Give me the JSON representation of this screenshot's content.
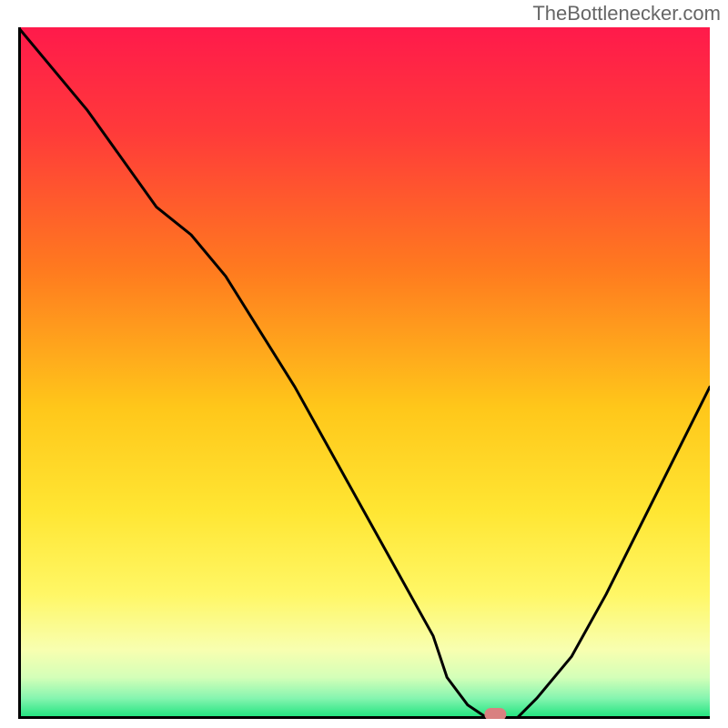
{
  "watermark": "TheBottlenecker.com",
  "chart_data": {
    "type": "line",
    "title": "",
    "xlabel": "",
    "ylabel": "",
    "xlim": [
      0,
      100
    ],
    "ylim": [
      0,
      100
    ],
    "series": [
      {
        "name": "curve",
        "x": [
          0,
          10,
          20,
          25,
          30,
          35,
          40,
          45,
          50,
          55,
          60,
          62,
          65,
          68,
          70,
          72,
          75,
          80,
          85,
          90,
          95,
          100
        ],
        "y": [
          100,
          88,
          74,
          70,
          64,
          56,
          48,
          39,
          30,
          21,
          12,
          6,
          2,
          0,
          0,
          0,
          3,
          9,
          18,
          28,
          38,
          48
        ]
      }
    ],
    "marker": {
      "x": 69,
      "y": 0
    },
    "gradient_stops": [
      {
        "offset": 0,
        "color": "#ff1a4b"
      },
      {
        "offset": 15,
        "color": "#ff3a3a"
      },
      {
        "offset": 35,
        "color": "#ff7a1f"
      },
      {
        "offset": 55,
        "color": "#ffc71a"
      },
      {
        "offset": 70,
        "color": "#ffe633"
      },
      {
        "offset": 82,
        "color": "#fff766"
      },
      {
        "offset": 90,
        "color": "#f8ffb0"
      },
      {
        "offset": 94,
        "color": "#d4ffb8"
      },
      {
        "offset": 97,
        "color": "#86f5b0"
      },
      {
        "offset": 100,
        "color": "#17e27a"
      }
    ],
    "axis_color": "#000000",
    "curve_color": "#000000",
    "marker_color": "#d98080"
  }
}
